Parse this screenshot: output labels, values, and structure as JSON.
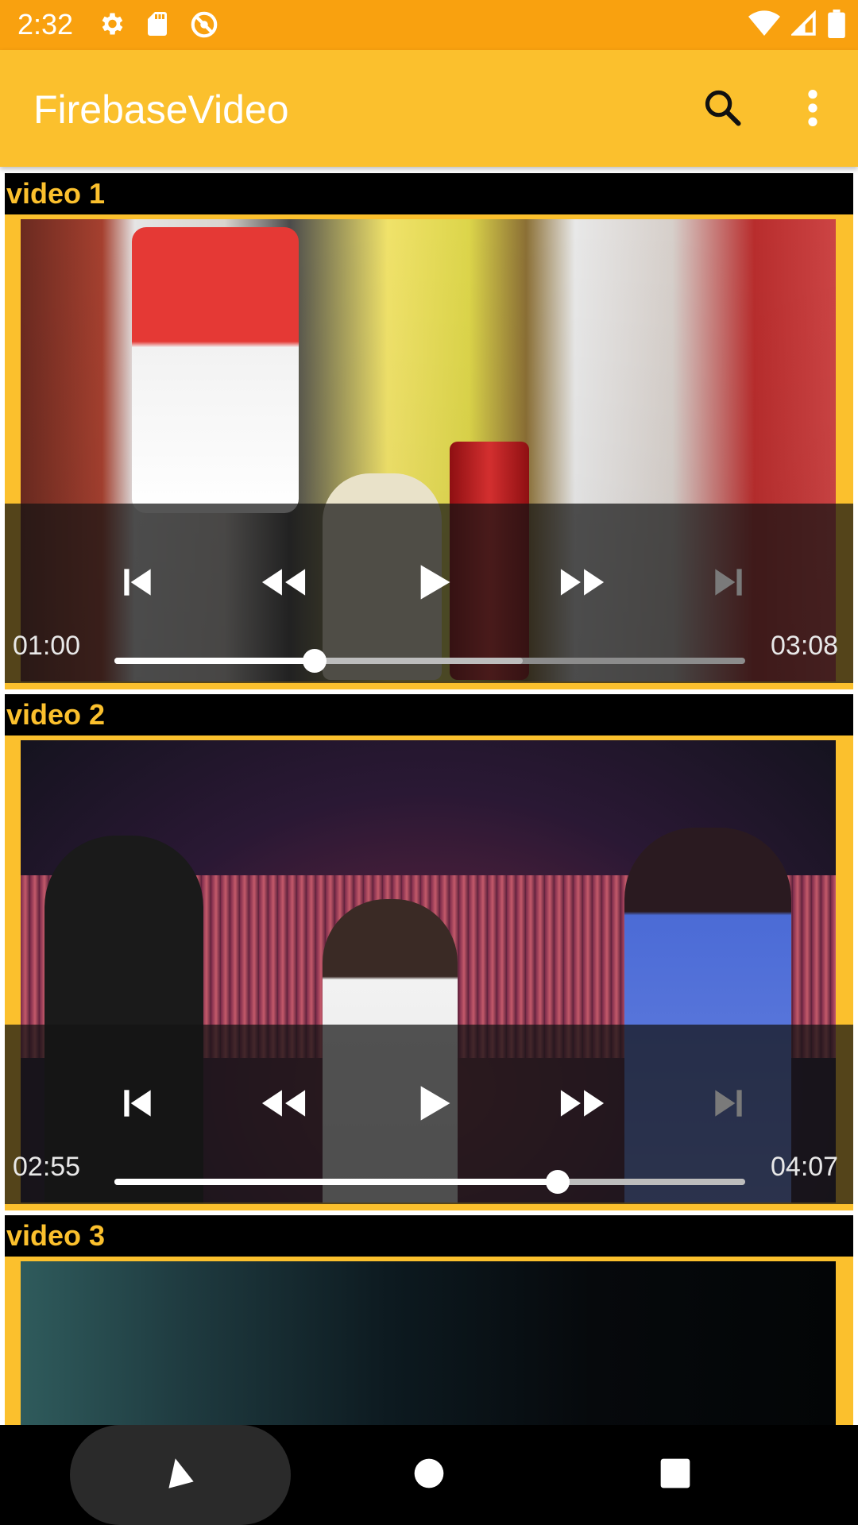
{
  "status_bar": {
    "time": "2:32",
    "left_icons": [
      "gear-icon",
      "sd-card-icon",
      "sync-disabled-icon"
    ],
    "right_icons": [
      "wifi-icon",
      "cell-signal-icon",
      "battery-icon"
    ],
    "background": "#f9a10f"
  },
  "app_bar": {
    "title": "FirebaseVideo",
    "actions": [
      "search-icon",
      "more-vert-icon"
    ],
    "background": "#fbc02d"
  },
  "videos": [
    {
      "title": "video 1",
      "current_time": "01:00",
      "total_time": "03:08",
      "progress": 0.318,
      "buffered": 0.647
    },
    {
      "title": "video 2",
      "current_time": "02:55",
      "total_time": "04:07",
      "progress": 0.703,
      "buffered": 1.0
    },
    {
      "title": "video 3"
    }
  ],
  "video_controls": [
    "skip-previous-icon",
    "rewind-icon",
    "play-icon",
    "fast-forward-icon",
    "skip-next-icon"
  ],
  "accent_color": "#fbc02d",
  "nav_bar": {
    "buttons": [
      "back-icon",
      "home-icon",
      "recents-icon"
    ]
  }
}
